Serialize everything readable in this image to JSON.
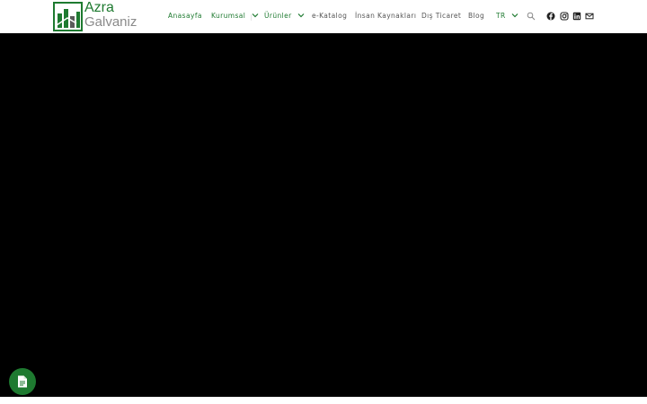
{
  "brand": {
    "line1": "Azra",
    "line2": "Galvaniz",
    "primary_color": "#1e7a30",
    "secondary_color": "#8a8a8a"
  },
  "nav": {
    "home": "Anasayfa",
    "corporate": "Kurumsal",
    "products": "Ürünler",
    "catalog": "e-Katalog",
    "hr": "İnsan Kaynakları",
    "trade": "Dış Ticaret",
    "blog": "Blog",
    "lang": "TR"
  },
  "header_icons": [
    "search-icon",
    "facebook-icon",
    "instagram-icon",
    "linkedin-icon",
    "mail-icon"
  ],
  "hero": {
    "background": "#000000"
  },
  "fab": {
    "icon": "document-icon",
    "color": "#1e7a30"
  }
}
